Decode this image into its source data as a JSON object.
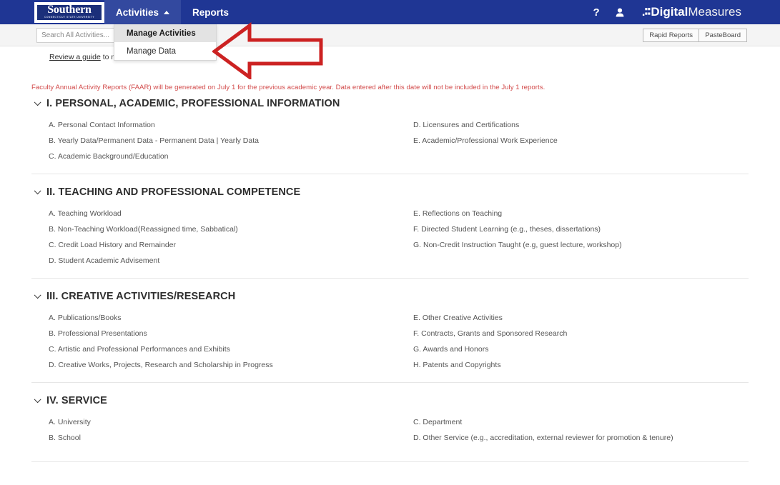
{
  "app": {
    "brand_primary": "#1f3694",
    "brand_accent": "#33499f",
    "notice_color": "#d24a4a",
    "annotation_color": "#cc2222"
  },
  "navbar": {
    "logo": {
      "word": "Southern",
      "subtitle": "CONNECTICUT STATE UNIVERSITY",
      "icon": "university-logo"
    },
    "items": [
      {
        "label": "Activities",
        "active": true,
        "caret": "caret-up-icon"
      },
      {
        "label": "Reports",
        "active": false
      }
    ],
    "help_icon": "?",
    "user_icon": "A",
    "product": {
      "dots": ".∶∶",
      "bold": "Digital",
      "light": "Measures"
    }
  },
  "dropdown": {
    "open": true,
    "items": [
      {
        "label": "Manage Activities",
        "highlighted": true
      },
      {
        "label": "Manage Data",
        "highlighted": false
      }
    ]
  },
  "toolbar": {
    "search_placeholder": "Search All Activities...",
    "search_value": "",
    "rapid_reports_label": "Rapid Reports",
    "pasteboard_label": "PasteBoard"
  },
  "guide": {
    "link_text": "Review a guide",
    "rest_text": " to manage your activities."
  },
  "notice": {
    "text": "Faculty Annual Activity Reports (FAAR) will be generated on July 1 for the previous academic year. Data entered after this date will not be included in the July 1 reports."
  },
  "sections": [
    {
      "title": "I. PERSONAL, ACADEMIC, PROFESSIONAL INFORMATION",
      "left": [
        "A. Personal Contact Information",
        "B. Yearly Data/Permanent Data - Permanent Data  |  Yearly Data",
        "C. Academic Background/Education"
      ],
      "right": [
        "D. Licensures and Certifications",
        "E. Academic/Professional Work Experience"
      ]
    },
    {
      "title": "II. TEACHING AND PROFESSIONAL COMPETENCE",
      "left": [
        "A. Teaching Workload",
        "B. Non-Teaching Workload(Reassigned time, Sabbatical)",
        "C. Credit Load History and Remainder",
        "D. Student Academic Advisement"
      ],
      "right": [
        "E. Reflections on Teaching",
        "F. Directed Student Learning (e.g., theses, dissertations)",
        "G. Non-Credit Instruction Taught (e.g, guest lecture, workshop)"
      ]
    },
    {
      "title": "III. CREATIVE ACTIVITIES/RESEARCH",
      "left": [
        "A. Publications/Books",
        "B. Professional Presentations",
        "C. Artistic and Professional Performances and Exhibits",
        "D. Creative Works, Projects, Research and Scholarship in Progress"
      ],
      "right": [
        "E. Other Creative Activities",
        "F. Contracts, Grants and Sponsored Research",
        "G. Awards and Honors",
        "H. Patents and Copyrights"
      ]
    },
    {
      "title": "IV. SERVICE",
      "left": [
        "A. University",
        "B. School"
      ],
      "right": [
        "C. Department",
        "D. Other Service (e.g., accreditation, external reviewer for promotion & tenure)"
      ]
    }
  ],
  "annotation": {
    "shape": "left-pointing-arrow",
    "color": "#cc2222"
  }
}
